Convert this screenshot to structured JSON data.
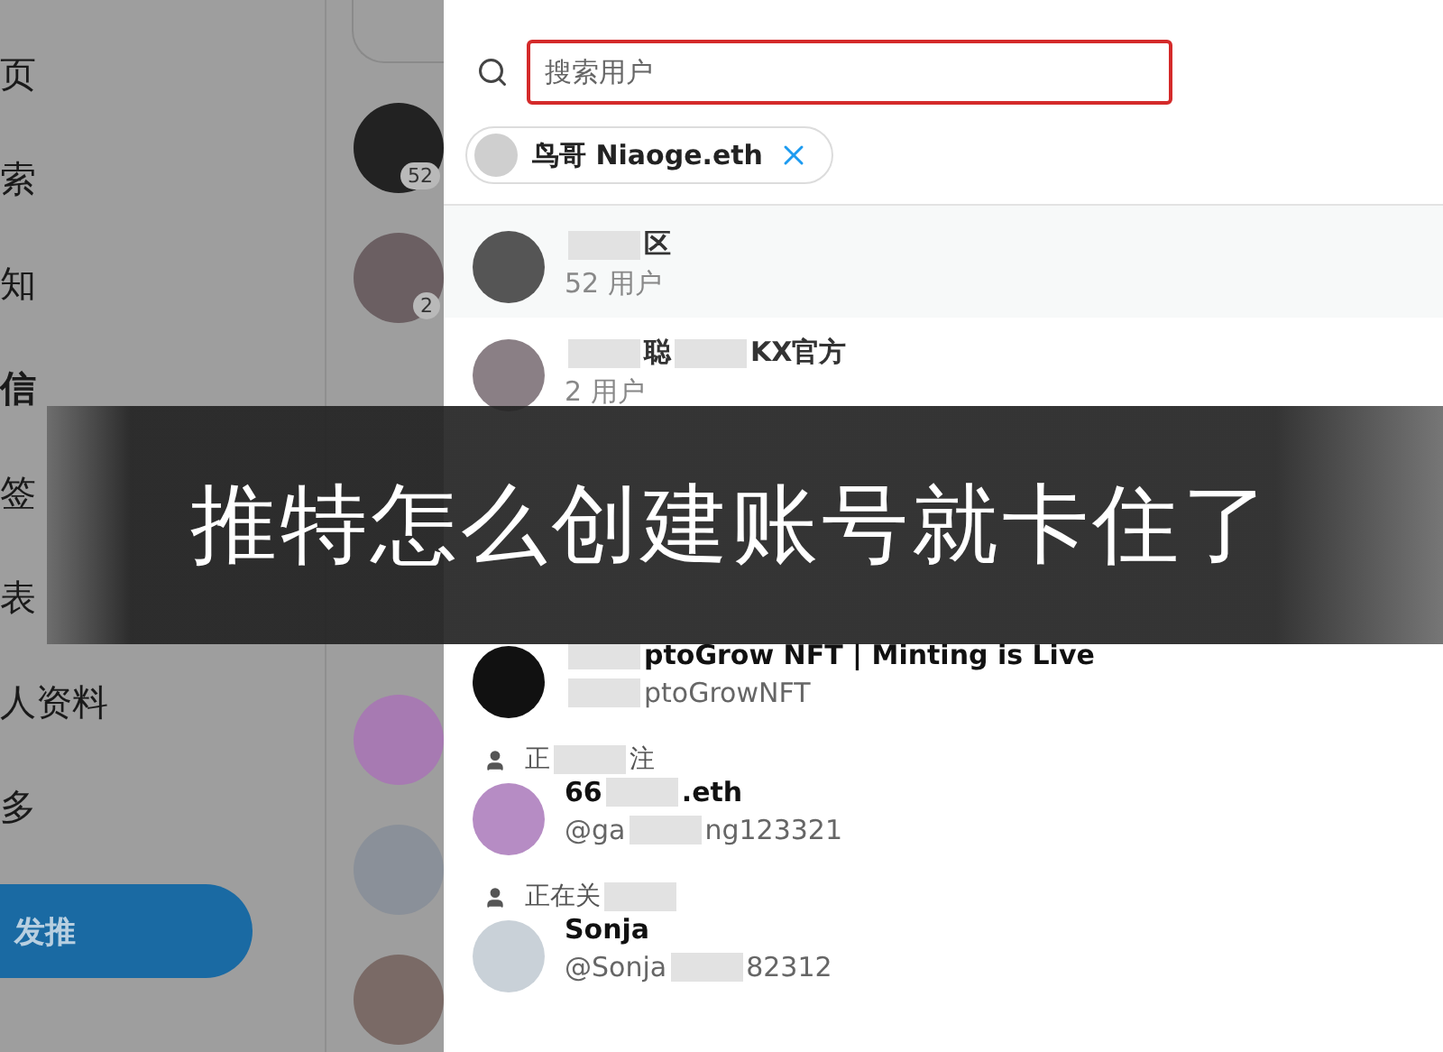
{
  "sidebar": {
    "nav_items": [
      {
        "label": "页",
        "selected": false
      },
      {
        "label": "索",
        "selected": false
      },
      {
        "label": "知",
        "selected": false
      },
      {
        "label": "信",
        "selected": true
      },
      {
        "label": "签",
        "selected": false
      },
      {
        "label": "表",
        "selected": false
      },
      {
        "label": "人资料",
        "selected": false
      },
      {
        "label": "多",
        "selected": false
      }
    ],
    "compose_button": "发推"
  },
  "conversations": [
    {
      "badge": "52"
    },
    {
      "badge": "2"
    }
  ],
  "modal": {
    "search": {
      "placeholder": "搜索用户"
    },
    "selected_chips": [
      {
        "label": "鸟哥 Niaoge.eth"
      }
    ],
    "results": [
      {
        "kind": "group",
        "name": [
          {
            "kind": "blur"
          },
          {
            "kind": "text",
            "text": "区"
          }
        ],
        "subtitle": [
          {
            "kind": "text",
            "text": "52 用户"
          }
        ]
      },
      {
        "kind": "group",
        "name": [
          {
            "kind": "blur"
          },
          {
            "kind": "text",
            "text": "聪"
          },
          {
            "kind": "blur"
          },
          {
            "kind": "text",
            "text": "KX官方"
          }
        ],
        "subtitle": [
          {
            "kind": "text",
            "text": "2 用户"
          }
        ]
      },
      {
        "kind": "user",
        "name": [
          {
            "kind": "blur"
          },
          {
            "kind": "text",
            "text": "ptoGrow NFT | Minting is Live"
          }
        ],
        "subtitle": [
          {
            "kind": "blur"
          },
          {
            "kind": "text",
            "text": "ptoGrowNFT"
          }
        ]
      },
      {
        "kind": "user",
        "context": [
          {
            "kind": "text",
            "text": "正"
          },
          {
            "kind": "blur"
          },
          {
            "kind": "text",
            "text": "注"
          }
        ],
        "name": [
          {
            "kind": "text",
            "text": "66"
          },
          {
            "kind": "blur"
          },
          {
            "kind": "text",
            "text": ".eth"
          }
        ],
        "subtitle": [
          {
            "kind": "text",
            "text": "@ga"
          },
          {
            "kind": "blur"
          },
          {
            "kind": "text",
            "text": "ng123321"
          }
        ]
      },
      {
        "kind": "user",
        "context": [
          {
            "kind": "text",
            "text": "正在关"
          },
          {
            "kind": "blur"
          }
        ],
        "name": [
          {
            "kind": "text",
            "text": "Sonja"
          }
        ],
        "subtitle": [
          {
            "kind": "text",
            "text": "@Sonja"
          },
          {
            "kind": "blur"
          },
          {
            "kind": "text",
            "text": "82312"
          }
        ]
      }
    ]
  },
  "banner": {
    "title": "推特怎么创建账号就卡住了"
  }
}
